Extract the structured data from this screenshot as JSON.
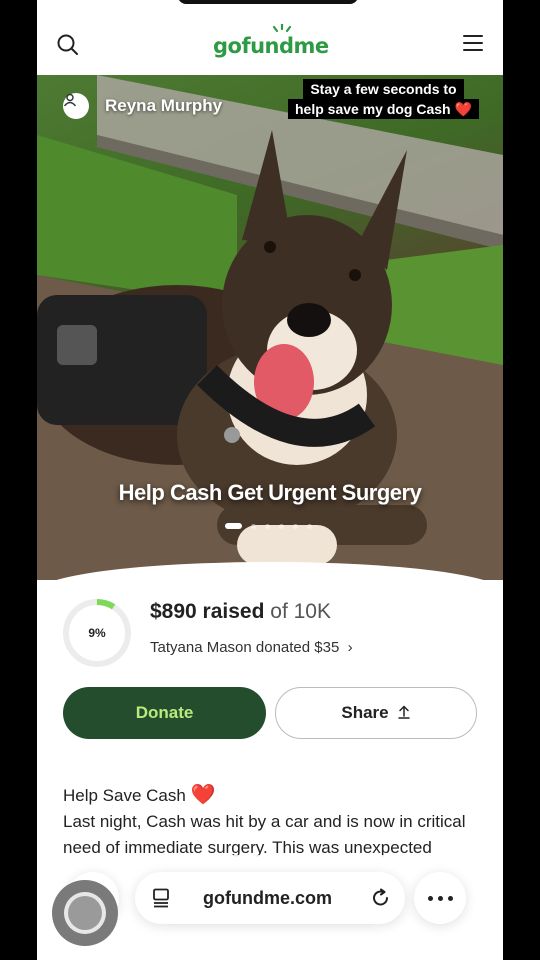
{
  "header": {
    "logo_text": "gofundme",
    "logo_color": "#2e9b44",
    "search_icon": "search-icon",
    "menu_icon": "hamburger-menu-icon"
  },
  "hero": {
    "owner_name": "Reyna Murphy",
    "caption_line1": "Stay a few seconds to",
    "caption_line2": "help save my dog Cash ❤️",
    "title": "Help Cash Get Urgent Surgery",
    "slide_count": 6,
    "active_slide": 1
  },
  "progress": {
    "percent_label": "9%",
    "percent_value": 0.09,
    "raised_amount": "$890 raised",
    "goal_text": "of 10K",
    "latest_donation": "Tatyana Mason donated $35",
    "ring_color": "#7ed957"
  },
  "actions": {
    "donate_label": "Donate",
    "share_label": "Share",
    "donate_bg": "#234d2c",
    "donate_text_color": "#b7eb7c"
  },
  "story": {
    "heading": "Help Save Cash",
    "heading_emoji": "❤️",
    "body": "Last night, Cash was hit by a car and is now in critical need of immediate surgery. This was unexpected"
  },
  "browser": {
    "url": "gofundme.com",
    "tab_icon": "tab-icon",
    "reload_icon": "reload-icon",
    "more_icon": "more-dots-icon"
  }
}
